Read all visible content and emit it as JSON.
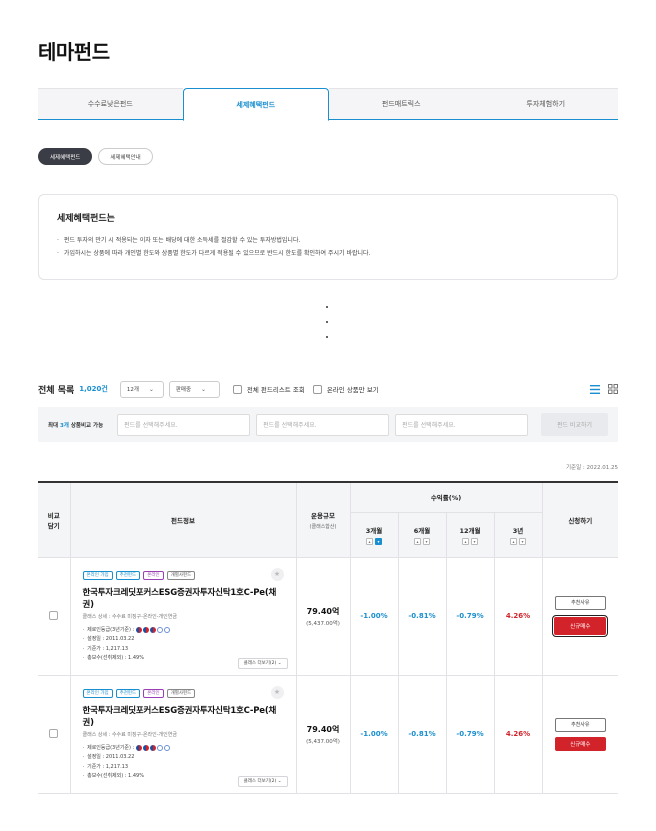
{
  "page": {
    "title": "테마펀드"
  },
  "tabs": [
    {
      "label": "수수료낮은펀드",
      "active": false
    },
    {
      "label": "세제혜택펀드",
      "active": true
    },
    {
      "label": "펀드매트릭스",
      "active": false
    },
    {
      "label": "투자체험하기",
      "active": false
    }
  ],
  "pills": [
    {
      "label": "세제혜택펀드",
      "active": true
    },
    {
      "label": "세제혜택안내",
      "active": false
    }
  ],
  "info": {
    "title": "세제혜택펀드는",
    "lines": [
      "펀드 투자의 만기 시 적용되는 이자 또는 배당에 대한 소득세를 절감할 수 있는 투자방법입니다.",
      "가입하시는 상품에 따라 개인별 한도와 상품별 한도가 다르게 적용될 수 있으므로 반드시 한도를 확인하여 주시기 바랍니다."
    ]
  },
  "list": {
    "title": "전체 목록",
    "count": "1,020건",
    "period_select": "12개",
    "status_select": "판매중",
    "check_all_label": "전체 펀드리스트 조회",
    "check_online_label": "온라인 상품만 보기"
  },
  "compare": {
    "label_prefix": "최대 ",
    "label_highlight": "3개",
    "label_suffix": " 상품비교 가능",
    "placeholder": "펀드를 선택해주세요.",
    "button_label": "펀드 비교하기"
  },
  "base_date": "기준일 : 2022.01.25",
  "table": {
    "headers": {
      "compare": "비교\n담기",
      "info": "펀드정보",
      "size": "운용규모",
      "size_sub": "(클래스합산)",
      "returns": "수익률(%)",
      "periods": [
        "3개월",
        "6개월",
        "12개월",
        "3년"
      ],
      "apply": "신청하기"
    },
    "rows": [
      {
        "tags": [
          "온라인 가입",
          "추천펀드",
          "온라인",
          "개별사펀드"
        ],
        "name": "한국투자크레딧포커스ESG증권자투자신탁1호C-Pe(채권)",
        "sub": "클래스 상세 : 수수료 미징구-온라인-개인연금",
        "risk_label": "제로인등급(3년기준) :",
        "setup_date": "설정일 : 2011.03.22",
        "base_price": "기준가 : 1,217.13",
        "total_fee": "총보수(선취제외) : 1.49%",
        "more": "클래스 더보기(2)",
        "size_main": "79.40억",
        "size_sub": "(5,437.00억)",
        "r3m": "-1.00%",
        "r6m": "-0.81%",
        "r12m": "-0.79%",
        "r3y": "4.26%",
        "reco_btn": "추천사유",
        "buy_btn": "신규매수"
      },
      {
        "tags": [
          "온라인 가입",
          "추천펀드",
          "온라인",
          "개별사펀드"
        ],
        "name": "한국투자크레딧포커스ESG증권자투자신탁1호C-Pe(채권)",
        "sub": "클래스 상세 : 수수료 미징구-온라인-개인연금",
        "risk_label": "제로인등급(3년기준) :",
        "setup_date": "설정일 : 2011.03.22",
        "base_price": "기준가 : 1,217.13",
        "total_fee": "총보수(선취제외) : 1.49%",
        "more": "클래스 더보기(2)",
        "size_main": "79.40억",
        "size_sub": "(5,437.00억)",
        "r3m": "-1.00%",
        "r6m": "-0.81%",
        "r12m": "-0.79%",
        "r3y": "4.26%",
        "reco_btn": "추천사유",
        "buy_btn": "신규매수"
      }
    ]
  },
  "colors": {
    "accent": "#1a8fd0",
    "negative": "#1a8fd0",
    "positive": "#d2232a",
    "buy": "#d2232a"
  }
}
